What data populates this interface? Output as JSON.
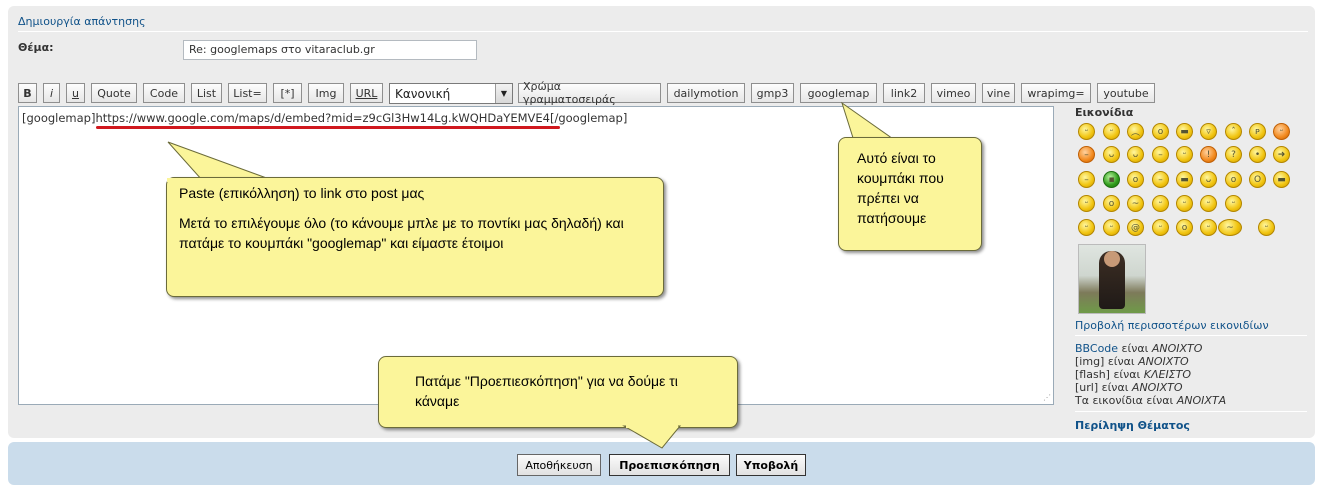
{
  "panel": {
    "title": "Δημιουργία απάντησης",
    "subject_label": "Θέμα:",
    "subject_value": "Re: googlemaps στο vitaraclub.gr"
  },
  "toolbar": {
    "buttons": [
      "B",
      "i",
      "u",
      "Quote",
      "Code",
      "List",
      "List=",
      "[*]",
      "Img",
      "URL"
    ],
    "font_select": "Κανονική",
    "buttons2": [
      "Χρώμα γραμματοσειράς",
      "dailymotion",
      "gmp3",
      "googlemap",
      "link2",
      "vimeo",
      "vine",
      "wrapimg=",
      "youtube"
    ]
  },
  "editor": {
    "open_tag": "[googlemap]",
    "link": "https://www.google.com/maps/d/embed?mid=z9cGl3Hw14Lg.kWQHDaYEMVE4",
    "close_tag": "[/googlemap]"
  },
  "sidebar": {
    "title": "Εικονίδια",
    "more_link": "Προβολή περισσοτέρων εικονιδίων",
    "status": [
      {
        "label": "BBCode",
        "text": " είναι ",
        "value": "ΑΝΟΙΧΤΟ"
      },
      {
        "label": "[img]",
        "text": " είναι ",
        "value": "ΑΝΟΙΧΤΟ"
      },
      {
        "label": "[flash]",
        "text": " είναι ",
        "value": "ΚΛΕΙΣΤΟ"
      },
      {
        "label": "[url]",
        "text": " είναι ",
        "value": "ΑΝΟΙΧΤΟ"
      },
      {
        "label": "Τα εικονίδια",
        "text": " είναι ",
        "value": "ΑΝΟΙΧΤΑ"
      }
    ],
    "topic_review": "Περίληψη Θέματος"
  },
  "footer": {
    "save": "Αποθήκευση",
    "preview": "Προεπισκόπηση",
    "submit": "Υποβολή"
  },
  "callouts": {
    "paste_line1": "Paste (επικόλληση) το link στο post μας",
    "paste_line2": "Μετά το επιλέγουμε όλο (το κάνουμε μπλε με το ποντίκι μας δηλαδή) και πατάμε το κουμπάκι \"googlemap\" και είμαστε έτοιμοι",
    "button_hint": "Αυτό είναι το κουμπάκι που πρέπει να πατήσουμε",
    "preview_hint": "Πατάμε \"Προεπιεσκόπηση\" για να δούμε τι κάναμε"
  },
  "colors": {
    "panel_bg": "#ececec",
    "footer_bg": "#cadceb",
    "link": "#105289",
    "callout_bg": "#fbf59a",
    "underline": "#d0181e"
  }
}
